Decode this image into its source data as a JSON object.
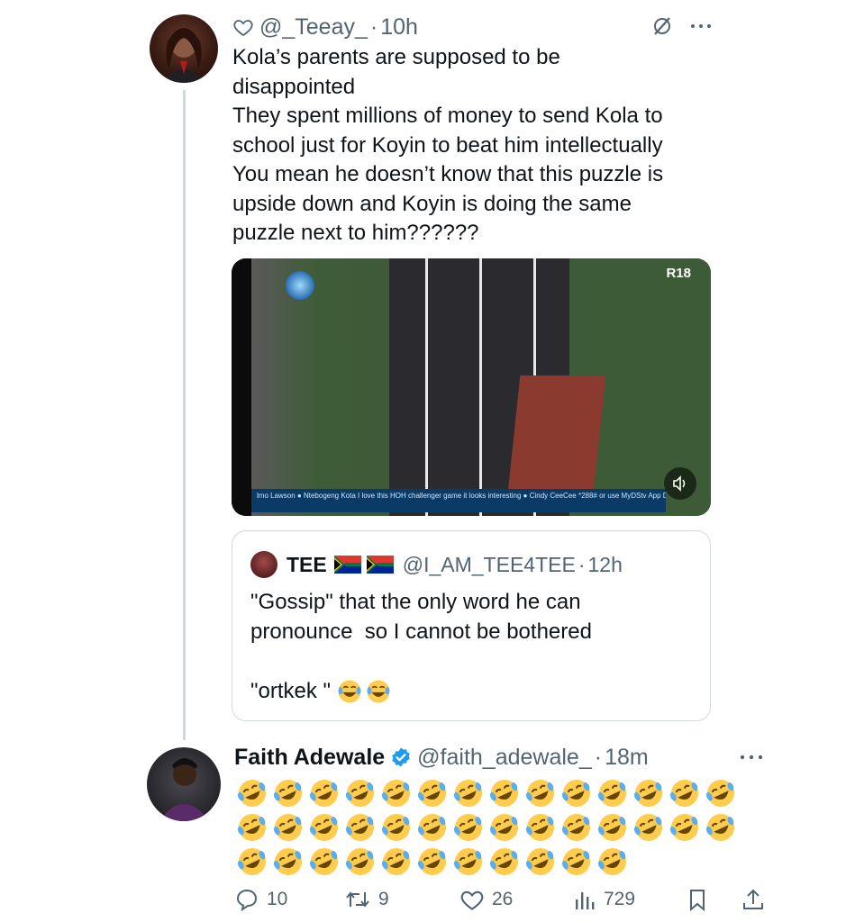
{
  "tweet1": {
    "handle": "@_Teeay_",
    "separator": "·",
    "time": "10h",
    "text_lines": [
      "Kola’s parents are supposed to be",
      "disappointed",
      "They spent millions of money to send Kola to",
      "school just for Koyin to beat him intellectually",
      "You mean he doesn’t know that this puzzle is",
      "upside down and Koyin is doing the same",
      "puzzle next to him??????"
    ],
    "media": {
      "rating": "R18",
      "ticker": "lmo Lawson  ● Ntebogeng Kota I love this HOH challenger game it looks interesting  ● Cindy CeeCee  *288# or use MyDStv App   Do more with the brand new MyDStv App today for easy self-service, offers, fun games"
    },
    "quote": {
      "name": "TEE",
      "handle": "@I_AM_TEE4TEE",
      "separator": "·",
      "time": "12h",
      "text_lines": [
        "\"Gossip\" that the only word he can",
        "pronounce  so I cannot be bothered",
        "",
        "\"ortkek \""
      ]
    }
  },
  "tweet2": {
    "name": "Faith Adewale",
    "handle": "@faith_adewale_",
    "separator": "·",
    "time": "18m",
    "emoji_rows": [
      14,
      14,
      11
    ],
    "actions": {
      "replies": "10",
      "retweets": "9",
      "likes": "26",
      "views": "729"
    }
  },
  "colors": {
    "text": "#0f1419",
    "muted": "#536471",
    "border": "#cfd9de",
    "verified": "#1d9bf0"
  },
  "icons": [
    "heart-icon",
    "mute-icon",
    "more-icon",
    "verified-icon",
    "reply-icon",
    "retweet-icon",
    "like-icon",
    "views-icon",
    "bookmark-icon",
    "share-icon",
    "volume-icon",
    "south-africa-flag-icon",
    "laughing-tears-emoji",
    "rofl-emoji"
  ]
}
